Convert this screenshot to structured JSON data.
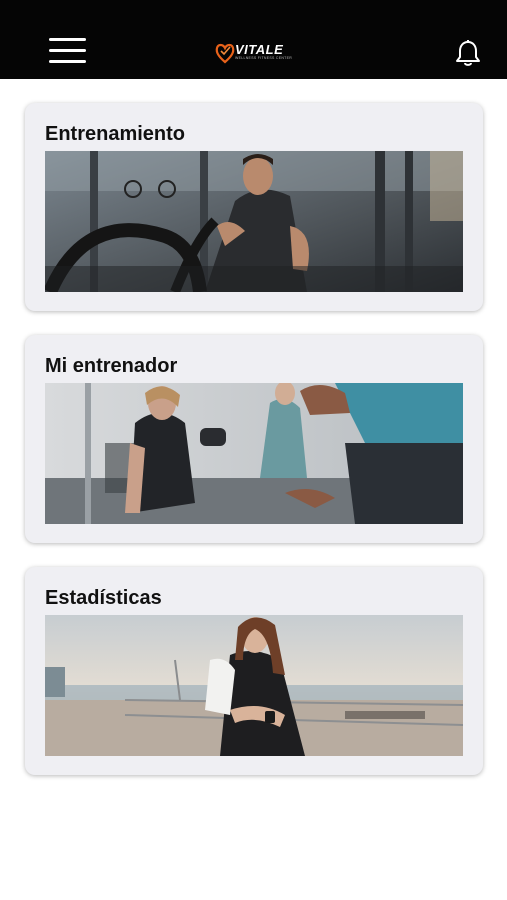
{
  "header": {
    "menu_icon": "hamburger-menu-icon",
    "logo_text": "VITALE",
    "logo_tagline": "WELLNESS FITNESS CENTER",
    "notification_icon": "bell-icon"
  },
  "cards": [
    {
      "title": "Entrenamiento",
      "image": "man training with battle ropes in gym"
    },
    {
      "title": "Mi entrenador",
      "image": "people working out with dumbbells and trainer"
    },
    {
      "title": "Estadísticas",
      "image": "woman checking smartwatch by the sea"
    }
  ],
  "colors": {
    "header_bg": "#050505",
    "card_bg": "#efeff3",
    "logo_accent": "#e8621a"
  }
}
